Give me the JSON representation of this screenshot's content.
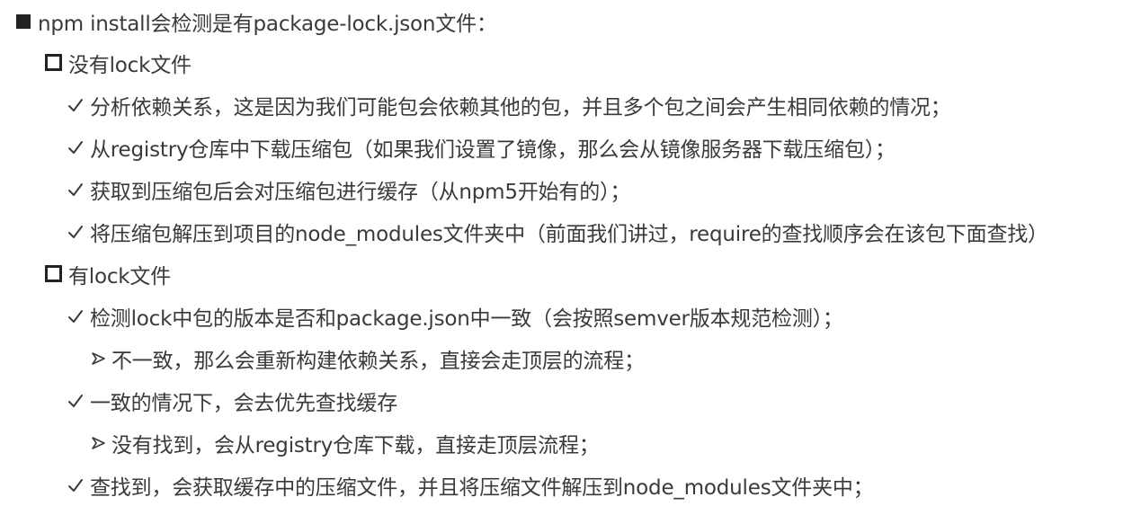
{
  "items": [
    {
      "level": 0,
      "bullet": "filled-square",
      "text": "npm install会检测是有package-lock.json文件："
    },
    {
      "level": 1,
      "bullet": "hollow-square",
      "text": "没有lock文件"
    },
    {
      "level": 2,
      "bullet": "checkmark",
      "text": "分析依赖关系，这是因为我们可能包会依赖其他的包，并且多个包之间会产生相同依赖的情况；"
    },
    {
      "level": 2,
      "bullet": "checkmark",
      "text": "从registry仓库中下载压缩包（如果我们设置了镜像，那么会从镜像服务器下载压缩包）；"
    },
    {
      "level": 2,
      "bullet": "checkmark",
      "text": "获取到压缩包后会对压缩包进行缓存（从npm5开始有的）；"
    },
    {
      "level": 2,
      "bullet": "checkmark",
      "text": "将压缩包解压到项目的node_modules文件夹中（前面我们讲过，require的查找顺序会在该包下面查找）"
    },
    {
      "level": 1,
      "bullet": "hollow-square",
      "text": "有lock文件"
    },
    {
      "level": 2,
      "bullet": "checkmark",
      "text": "检测lock中包的版本是否和package.json中一致（会按照semver版本规范检测）；"
    },
    {
      "level": 3,
      "bullet": "arrow",
      "text": "不一致，那么会重新构建依赖关系，直接会走顶层的流程；"
    },
    {
      "level": 2,
      "bullet": "checkmark",
      "text": "一致的情况下，会去优先查找缓存"
    },
    {
      "level": 3,
      "bullet": "arrow",
      "text": "没有找到，会从registry仓库下载，直接走顶层流程；"
    },
    {
      "level": 2,
      "bullet": "checkmark",
      "text": "查找到，会获取缓存中的压缩文件，并且将压缩文件解压到node_modules文件夹中；"
    }
  ]
}
